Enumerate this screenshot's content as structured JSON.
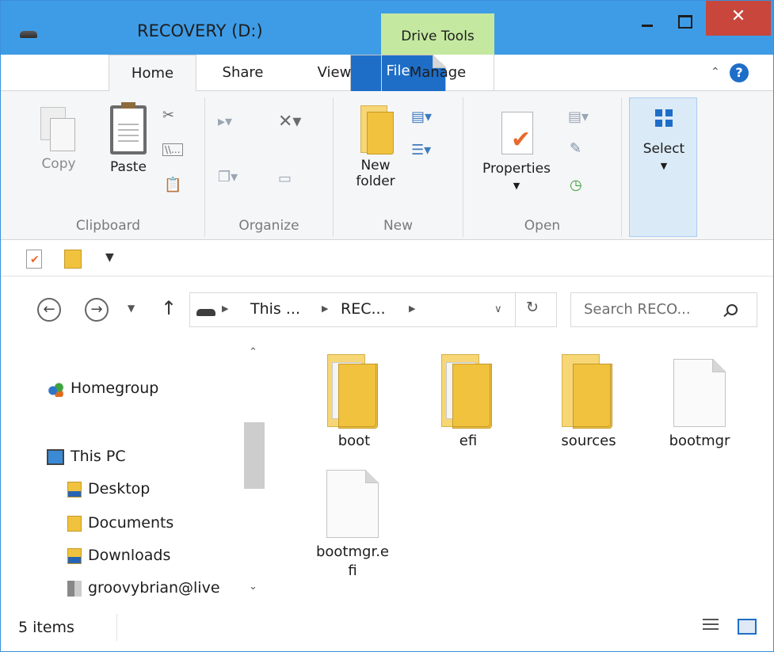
{
  "window": {
    "title": "RECOVERY (D:)",
    "contextual_tab_group": "Drive Tools",
    "close_glyph": "✕"
  },
  "tabs": {
    "file": "File",
    "home": "Home",
    "share": "Share",
    "view": "View",
    "manage": "Manage"
  },
  "ribbon": {
    "clipboard": {
      "copy": "Copy",
      "paste": "Paste",
      "group_label": "Clipboard"
    },
    "organize": {
      "group_label": "Organize"
    },
    "new": {
      "new_folder_line1": "New",
      "new_folder_line2": "folder",
      "group_label": "New"
    },
    "open": {
      "properties": "Properties",
      "group_label": "Open"
    },
    "select": {
      "label": "Select"
    }
  },
  "address_bar": {
    "crumbs": [
      "This ...",
      "REC..."
    ],
    "search_placeholder": "Search RECO..."
  },
  "nav_pane": {
    "items": [
      {
        "label": "Homegroup",
        "icon": "homegroup-icon"
      },
      {
        "label": "This PC",
        "icon": "computer-icon"
      },
      {
        "label": "Desktop",
        "icon": "desktop-folder-icon"
      },
      {
        "label": "Documents",
        "icon": "documents-folder-icon"
      },
      {
        "label": "Downloads",
        "icon": "downloads-folder-icon"
      },
      {
        "label": "groovybrian@live",
        "icon": "user-icon"
      }
    ]
  },
  "files": [
    {
      "name": "boot",
      "type": "folder"
    },
    {
      "name": "efi",
      "type": "folder"
    },
    {
      "name": "sources",
      "type": "folder"
    },
    {
      "name": "bootmgr",
      "type": "file"
    },
    {
      "name": "bootmgr.efi",
      "type": "file"
    }
  ],
  "status": {
    "item_count": "5 items"
  },
  "colors": {
    "titlebar": "#3e9ce6",
    "file_tab": "#1e6ec7",
    "drive_tools": "#c5e8a0",
    "close": "#c8463c",
    "folder": "#f0c23e"
  }
}
